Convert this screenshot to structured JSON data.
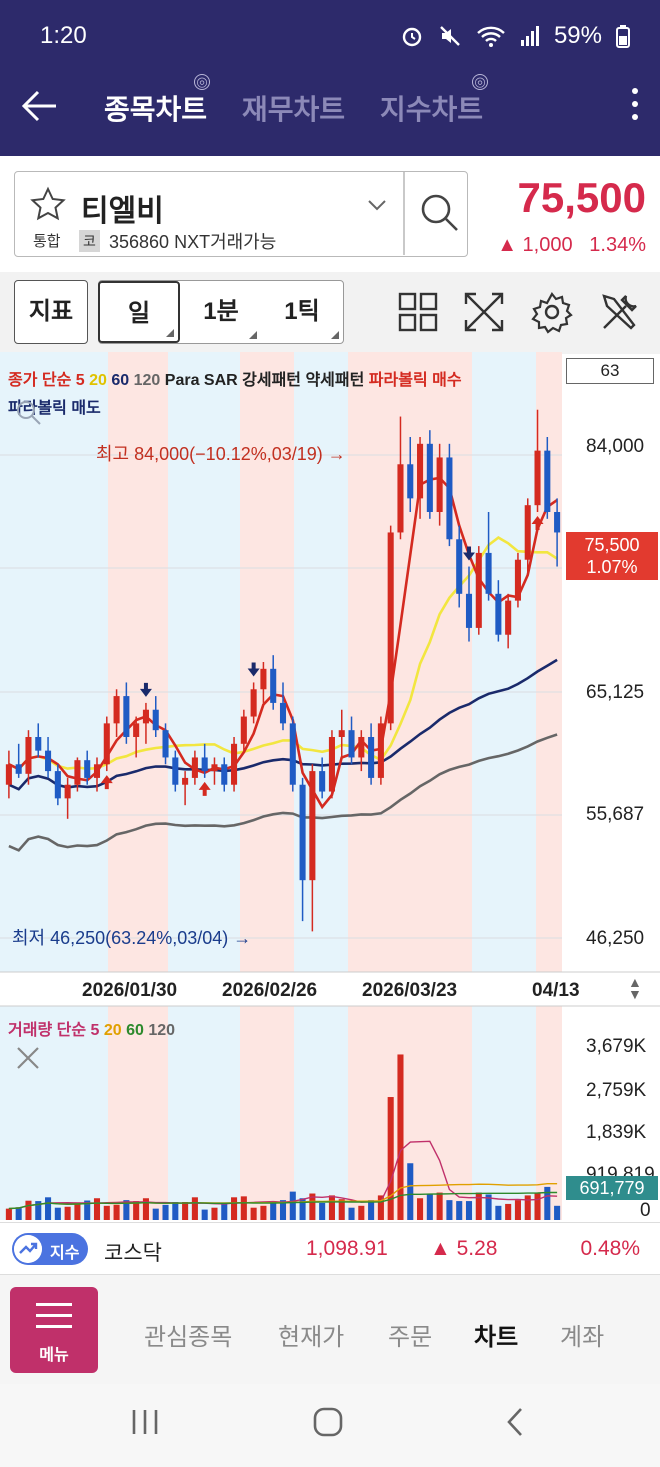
{
  "status": {
    "time": "1:20",
    "battery": "59%"
  },
  "header": {
    "tabs": [
      {
        "label": "종목차트",
        "active": true
      },
      {
        "label": "재무차트",
        "active": false
      },
      {
        "label": "지수차트",
        "active": false
      }
    ]
  },
  "stock": {
    "name": "티엘비",
    "market": "통합",
    "exchange": "코",
    "code_text": "356860 NXT거래가능",
    "price": "75,500",
    "change": "▲ 1,000",
    "change_pct": "1.34%"
  },
  "toolbar": {
    "indicator_label": "지표",
    "period_day": "일",
    "period_min": "1분",
    "period_tick": "1틱"
  },
  "chart": {
    "legend1_parts": [
      {
        "text": "종가 단순 5 ",
        "color": "#d42a20"
      },
      {
        "text": "20 ",
        "color": "#e0c200"
      },
      {
        "text": "60 ",
        "color": "#1a2a6b"
      },
      {
        "text": "120 ",
        "color": "#666666"
      },
      {
        "text": "Para SAR 강세패턴 약세패턴 ",
        "color": "#222222"
      },
      {
        "text": "파라볼릭 매수",
        "color": "#d42a20"
      }
    ],
    "legend2": "파라볼릭 매도",
    "period_count": "63",
    "high_annotation": "최고 84,000(−10.12%,03/19) →",
    "low_annotation": "최저 46,250(63.24%,03/04) →",
    "current_price_tag": "75,500",
    "current_pct_tag": "1.07%",
    "volume_legend_parts": [
      {
        "text": "거래량 단순 ",
        "color": "#c0306a"
      },
      {
        "text": "5 ",
        "color": "#c0306a"
      },
      {
        "text": "20 ",
        "color": "#e0a000"
      },
      {
        "text": "60 ",
        "color": "#2d8a2d"
      },
      {
        "text": "120",
        "color": "#666666"
      }
    ],
    "volume_tag": "691,779",
    "volume_partial_label": "919,819",
    "close_icon": "close-icon"
  },
  "chart_data": {
    "type": "candlestick",
    "price_axis_ticks": [
      "84,000",
      "65,125",
      "55,687",
      "46,250"
    ],
    "volume_axis_ticks": [
      "3,679K",
      "2,759K",
      "1,839K",
      "0"
    ],
    "x_ticks": [
      "2026/01/30",
      "2026/02/26",
      "2026/03/23",
      "04/13"
    ],
    "high": {
      "value": 84000,
      "date": "03/19"
    },
    "low": {
      "value": 46250,
      "date": "03/04"
    },
    "ylim": [
      44000,
      88000
    ],
    "candles": [
      [
        57000,
        59500,
        56000,
        58500
      ],
      [
        58500,
        60000,
        57500,
        57800
      ],
      [
        57800,
        61000,
        57000,
        60500
      ],
      [
        60500,
        61500,
        59000,
        59500
      ],
      [
        59500,
        60500,
        57500,
        58000
      ],
      [
        58000,
        58500,
        55500,
        56000
      ],
      [
        56000,
        57500,
        54500,
        57000
      ],
      [
        57000,
        59000,
        56500,
        58800
      ],
      [
        58800,
        59500,
        57000,
        57500
      ],
      [
        57500,
        59000,
        56500,
        58500
      ],
      [
        58500,
        62000,
        58000,
        61500
      ],
      [
        61500,
        64000,
        60500,
        63500
      ],
      [
        63500,
        64500,
        60000,
        60500
      ],
      [
        60500,
        62000,
        59000,
        61500
      ],
      [
        61500,
        63000,
        60000,
        62500
      ],
      [
        62500,
        63500,
        60500,
        61000
      ],
      [
        61000,
        61500,
        58500,
        59000
      ],
      [
        59000,
        59500,
        56500,
        57000
      ],
      [
        57000,
        58000,
        55500,
        57500
      ],
      [
        57500,
        59500,
        57000,
        59000
      ],
      [
        59000,
        60000,
        57500,
        58000
      ],
      [
        58000,
        59000,
        57000,
        58500
      ],
      [
        58500,
        59000,
        56500,
        57000
      ],
      [
        57000,
        60500,
        56500,
        60000
      ],
      [
        60000,
        62500,
        59500,
        62000
      ],
      [
        62000,
        64500,
        61500,
        64000
      ],
      [
        64000,
        66000,
        63000,
        65500
      ],
      [
        65500,
        66500,
        62500,
        63000
      ],
      [
        63000,
        64500,
        61000,
        61500
      ],
      [
        61500,
        62000,
        56500,
        57000
      ],
      [
        57000,
        57500,
        47000,
        50000
      ],
      [
        50000,
        58500,
        46250,
        58000
      ],
      [
        58000,
        59000,
        56000,
        56500
      ],
      [
        56500,
        61000,
        56000,
        60500
      ],
      [
        60500,
        62500,
        59000,
        61000
      ],
      [
        61000,
        62000,
        58500,
        59000
      ],
      [
        59000,
        61000,
        58000,
        60500
      ],
      [
        60500,
        61500,
        57000,
        57500
      ],
      [
        57500,
        62000,
        57000,
        61500
      ],
      [
        61500,
        76000,
        61000,
        75500
      ],
      [
        75500,
        84000,
        75000,
        80500
      ],
      [
        80500,
        82500,
        77000,
        78000
      ],
      [
        78000,
        82500,
        76500,
        82000
      ],
      [
        82000,
        83000,
        76500,
        77000
      ],
      [
        77000,
        82000,
        76000,
        81000
      ],
      [
        81000,
        82000,
        74500,
        75000
      ],
      [
        75000,
        76000,
        70000,
        71000
      ],
      [
        71000,
        73000,
        67500,
        68500
      ],
      [
        68500,
        74500,
        68000,
        74000
      ],
      [
        74000,
        77000,
        70500,
        71000
      ],
      [
        71000,
        72000,
        67500,
        68000
      ],
      [
        68000,
        71000,
        67000,
        70500
      ],
      [
        70500,
        74000,
        70000,
        73500
      ],
      [
        73500,
        78000,
        72500,
        77500
      ],
      [
        77500,
        84500,
        77000,
        81500
      ],
      [
        81500,
        82500,
        76500,
        77000
      ],
      [
        77000,
        78000,
        73000,
        75500
      ]
    ],
    "volume_series": [
      "5",
      "20",
      "60",
      "120"
    ]
  },
  "index_bar": {
    "badge": "지수",
    "name": "코스닥",
    "value": "1,098.91",
    "change": "▲ 5.28",
    "pct": "0.48%"
  },
  "bottom_nav": {
    "menu_label": "메뉴",
    "items": [
      {
        "label": "관심종목",
        "active": false
      },
      {
        "label": "현재가",
        "active": false
      },
      {
        "label": "주문",
        "active": false
      },
      {
        "label": "차트",
        "active": true
      },
      {
        "label": "계좌",
        "active": false
      }
    ]
  },
  "colors": {
    "header_bg": "#2d2a6b",
    "up": "#d42a20",
    "down": "#1f5bc4",
    "accent": "#c0306a"
  }
}
